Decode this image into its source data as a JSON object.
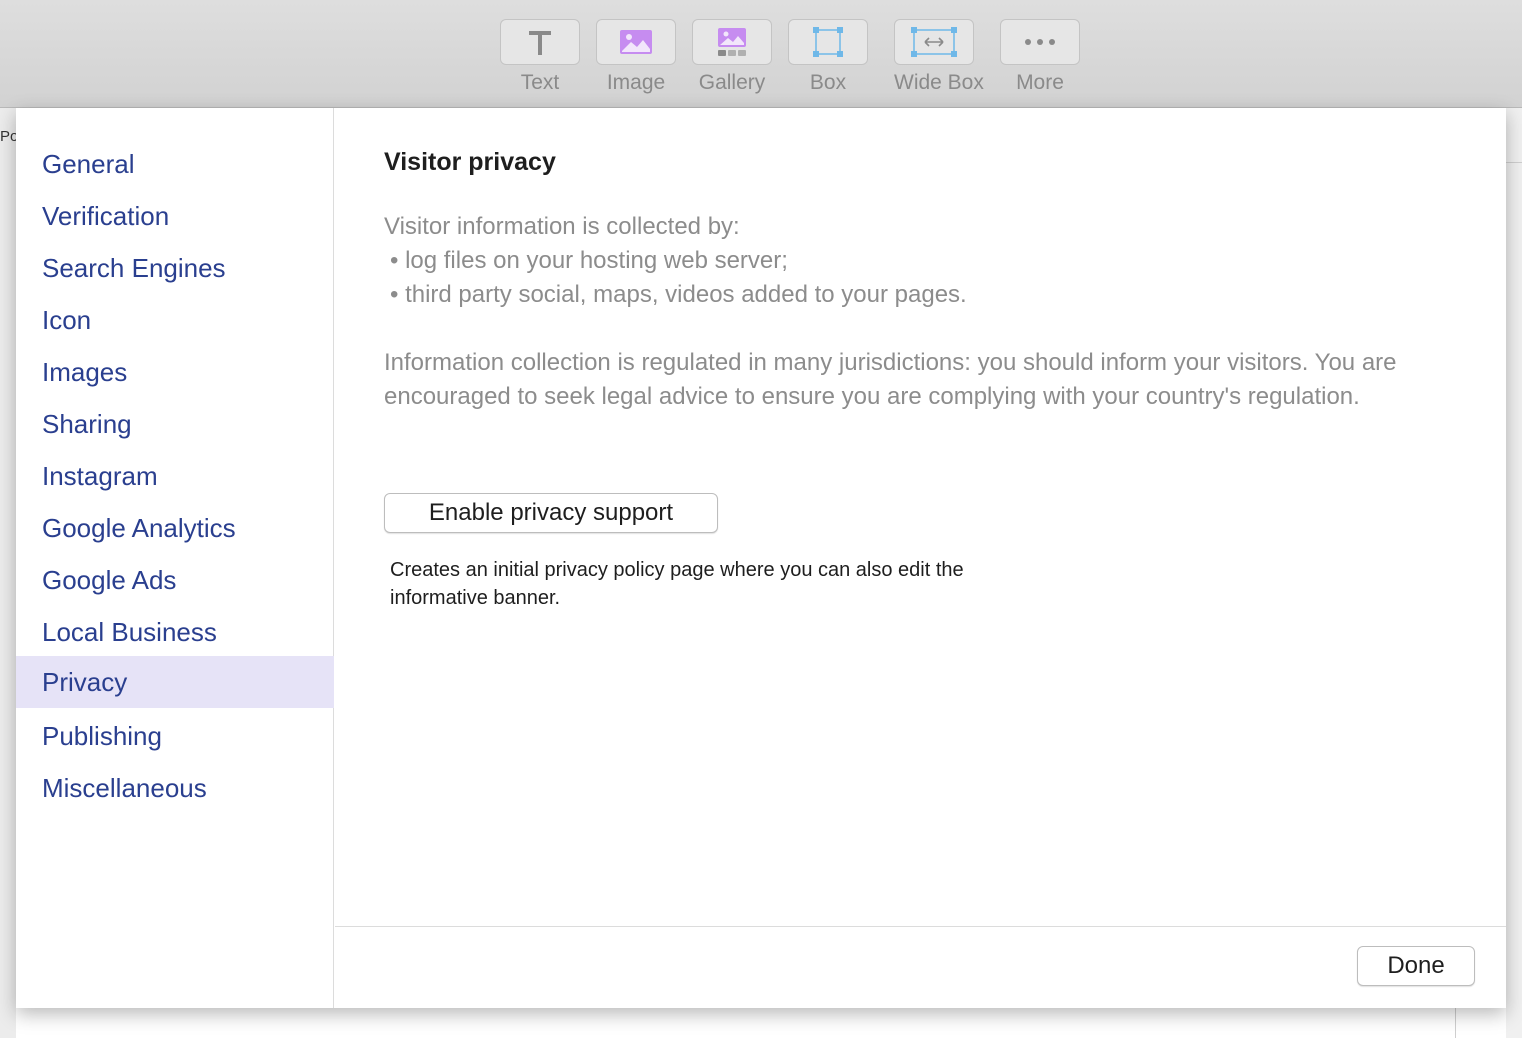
{
  "toolbar": {
    "items": [
      {
        "label": "Text",
        "icon": "text-icon"
      },
      {
        "label": "Image",
        "icon": "image-icon"
      },
      {
        "label": "Gallery",
        "icon": "gallery-icon"
      },
      {
        "label": "Box",
        "icon": "box-icon"
      },
      {
        "label": "Wide Box",
        "icon": "wide-box-icon"
      },
      {
        "label": "More",
        "icon": "more-icon"
      }
    ]
  },
  "background": {
    "left_edge_text": "Po"
  },
  "sidebar": {
    "items": [
      {
        "label": "General"
      },
      {
        "label": "Verification"
      },
      {
        "label": "Search Engines"
      },
      {
        "label": "Icon"
      },
      {
        "label": "Images"
      },
      {
        "label": "Sharing"
      },
      {
        "label": "Instagram"
      },
      {
        "label": "Google Analytics"
      },
      {
        "label": "Google Ads"
      },
      {
        "label": "Local Business"
      },
      {
        "label": "Privacy",
        "selected": true
      },
      {
        "label": "Publishing"
      },
      {
        "label": "Miscellaneous"
      }
    ]
  },
  "content": {
    "title": "Visitor privacy",
    "collected_by": "Visitor information is collected by:",
    "bullet1": "• log files on your hosting web server;",
    "bullet2": "• third party social, maps, videos added to your pages.",
    "regulation": "Information collection is regulated in many jurisdictions: you should inform your visitors. You are encouraged to seek legal advice to ensure you are complying with your country's regulation.",
    "enable_button": "Enable privacy support",
    "hint": "Creates an initial privacy policy page where you can also edit the informative banner."
  },
  "footer": {
    "done_button": "Done"
  },
  "colors": {
    "sidebar_link": "#2a3f8f",
    "selected_bg": "#e6e3f7",
    "muted_text": "#8c8c8c",
    "icon_purple": "#b56fe0",
    "icon_blue": "#6fb8e8"
  }
}
